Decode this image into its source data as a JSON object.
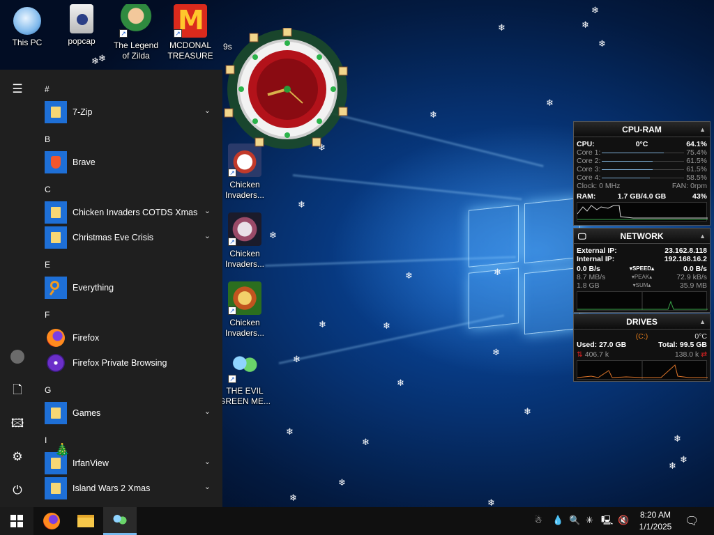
{
  "desktop": {
    "icons": [
      {
        "label": "This PC"
      },
      {
        "label": "popcap"
      },
      {
        "label": "The Legend of Zilda"
      },
      {
        "label": "MCDONAL TREASURE"
      },
      {
        "label": "Chicken Invaders..."
      },
      {
        "label": "Chicken Invaders..."
      },
      {
        "label": "Chicken Invaders..."
      },
      {
        "label": "THE EVIL GREEN ME..."
      }
    ],
    "partial_label": "9s"
  },
  "start_menu": {
    "sections": [
      {
        "letter": "#",
        "apps": [
          {
            "name": "7-Zip",
            "icon": "folder-icon",
            "expandable": true
          }
        ]
      },
      {
        "letter": "B",
        "apps": [
          {
            "name": "Brave",
            "icon": "brave-icon",
            "expandable": false
          }
        ]
      },
      {
        "letter": "C",
        "apps": [
          {
            "name": "Chicken Invaders COTDS Xmas",
            "icon": "folder-icon",
            "expandable": true
          },
          {
            "name": "Christmas Eve Crisis",
            "icon": "folder-icon",
            "expandable": true
          }
        ]
      },
      {
        "letter": "E",
        "apps": [
          {
            "name": "Everything",
            "icon": "magnifier-icon",
            "expandable": false
          }
        ]
      },
      {
        "letter": "F",
        "apps": [
          {
            "name": "Firefox",
            "icon": "firefox-icon",
            "expandable": false
          },
          {
            "name": "Firefox Private Browsing",
            "icon": "firefox-private-icon",
            "expandable": false
          }
        ]
      },
      {
        "letter": "G",
        "apps": [
          {
            "name": "Games",
            "icon": "folder-icon",
            "expandable": true
          }
        ]
      },
      {
        "letter": "I",
        "apps": [
          {
            "name": "IrfanView",
            "icon": "folder-icon",
            "expandable": true
          },
          {
            "name": "Island Wars 2 Xmas",
            "icon": "folder-icon",
            "expandable": true
          }
        ]
      }
    ],
    "rail": [
      "hamburger-icon",
      "user-avatar-icon",
      "documents-icon",
      "pictures-icon",
      "settings-icon",
      "power-icon"
    ]
  },
  "gadgets": {
    "cpu_ram": {
      "title": "CPU-RAM",
      "cpu_label": "CPU:",
      "cpu_temp": "0°C",
      "cpu_usage": "64.1%",
      "cores": [
        {
          "label": "Core 1:",
          "value": "75.4%",
          "fraction": 0.754
        },
        {
          "label": "Core 2:",
          "value": "61.5%",
          "fraction": 0.615
        },
        {
          "label": "Core 3:",
          "value": "61.5%",
          "fraction": 0.615
        },
        {
          "label": "Core 4:",
          "value": "58.5%",
          "fraction": 0.585
        }
      ],
      "clock": "Clock: 0 MHz",
      "fan": "FAN: 0rpm",
      "ram_label": "RAM:",
      "ram_value": "1.7 GB/4.0 GB",
      "ram_pct": "43%"
    },
    "network": {
      "title": "NETWORK",
      "external_label": "External IP:",
      "external_ip": "23.162.8.118",
      "internal_label": "Internal IP:",
      "internal_ip": "192.168.16.2",
      "rows": [
        {
          "left": "0.0 B/s",
          "label": "SPEED",
          "right": "0.0 B/s"
        },
        {
          "left": "8.7 MB/s",
          "label": "PEAK",
          "right": "72.9 kB/s"
        },
        {
          "left": "1.8 GB",
          "label": "SUM",
          "right": "35.9 MB"
        }
      ]
    },
    "drives": {
      "title": "DRIVES",
      "drive_letter": "(C:)",
      "temp": "0°C",
      "used": "Used: 27.0 GB",
      "total": "Total: 99.5 GB",
      "read": "406.7 k",
      "write": "138.0 k"
    }
  },
  "taskbar": {
    "pinned": [
      "start-icon",
      "firefox-icon",
      "file-explorer-icon",
      "game-app-icon"
    ],
    "time": "8:20 AM",
    "date": "1/1/2025"
  },
  "colors": {
    "accent": "#1e6fd6",
    "menu_bg": "#1f1f1f",
    "taskbar_bg": "#101010"
  }
}
